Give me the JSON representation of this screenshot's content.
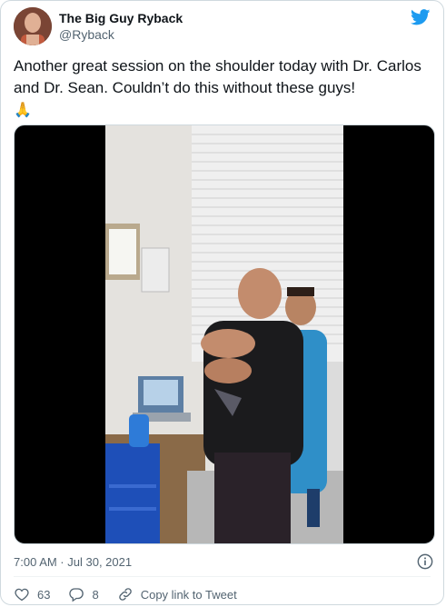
{
  "tweet": {
    "author": {
      "display_name": "The Big Guy Ryback",
      "handle": "@Ryback"
    },
    "text": "Another great session on the shoulder today with Dr. Carlos and Dr. Sean. Couldn’t do this without these guys!",
    "emoji": "🙏",
    "timestamp": "7:00 AM · Jul 30, 2021",
    "actions": {
      "like_count": "63",
      "reply_count": "8",
      "copy_link_label": "Copy link to Tweet"
    }
  },
  "colors": {
    "brand_blue": "#1d9bf0",
    "text_primary": "#0f1419",
    "text_secondary": "#536471",
    "border": "#cfd9de"
  },
  "icons": [
    "twitter-bird-icon",
    "info-icon",
    "heart-icon",
    "reply-bubble-icon",
    "link-icon"
  ]
}
